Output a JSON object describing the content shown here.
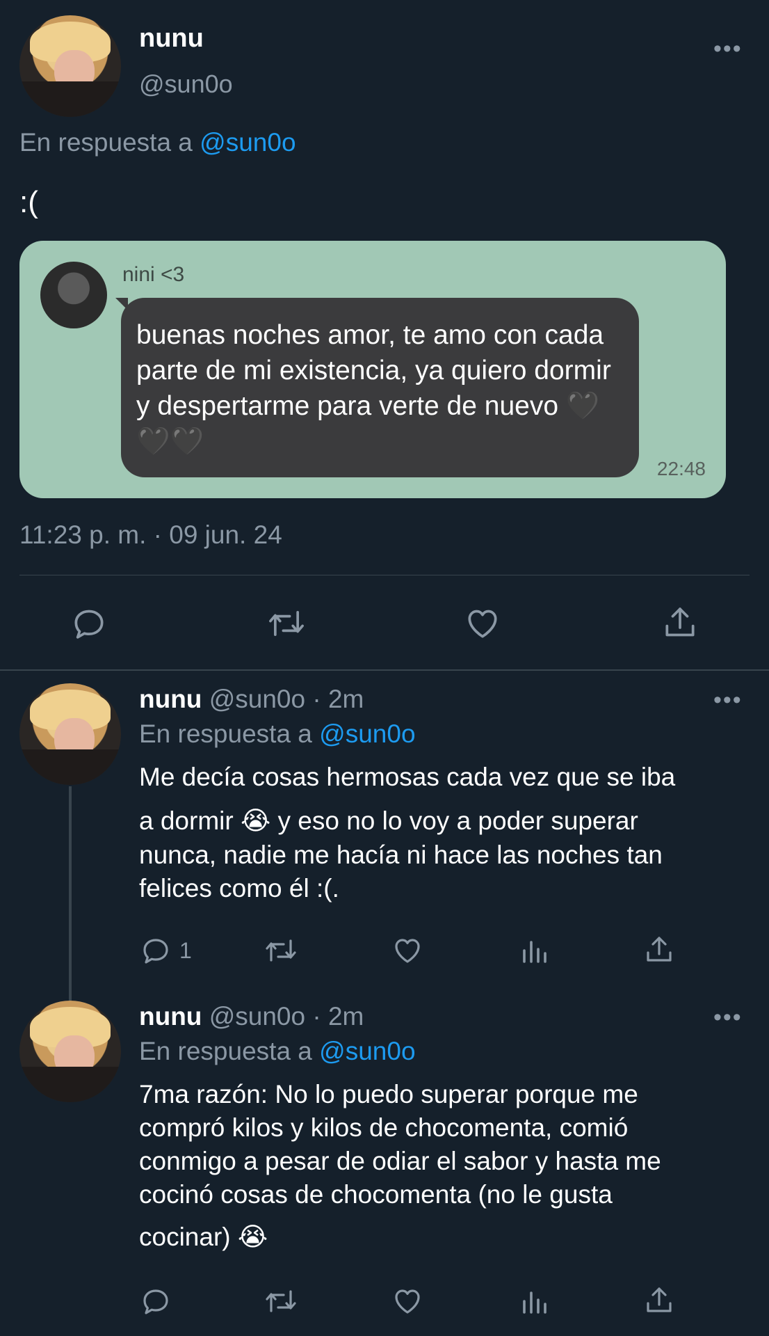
{
  "main_tweet": {
    "name": "nunu",
    "handle": "@sun0o",
    "reply_prefix": "En respuesta a",
    "reply_to": "@sun0o",
    "text": ":(",
    "timestamp": "11:23 p. m. · 09 jun. 24",
    "chat_image": {
      "sender": "nini <3",
      "message": "buenas noches amor, te amo con cada parte de mi existencia, ya quiero dormir y despertarme para verte de nuevo",
      "hearts": "🖤🖤🖤",
      "time": "22:48",
      "bg_color": "#a1c8b5",
      "bubble_color": "#3b3b3d"
    }
  },
  "replies": [
    {
      "name": "nunu",
      "handle": "@sun0o",
      "time": "· 2m",
      "reply_prefix": "En respuesta a",
      "reply_to": "@sun0o",
      "lines": [
        "Me decía cosas hermosas cada vez que se iba",
        "a dormir 😭  y eso no lo voy a poder superar",
        "nunca, nadie me hacía ni hace las noches tan",
        "felices como él :(."
      ],
      "reply_count": "1"
    },
    {
      "name": "nunu",
      "handle": "@sun0o",
      "time": "· 2m",
      "reply_prefix": "En respuesta a",
      "reply_to": "@sun0o",
      "lines": [
        "7ma razón: No lo puedo superar porque me",
        "compró kilos y kilos de chocomenta, comió",
        "conmigo a pesar de odiar el sabor y hasta me",
        "cocinó cosas de chocomenta (no le gusta",
        "cocinar) 😭"
      ],
      "reply_count": ""
    }
  ],
  "icons": [
    "more-icon",
    "reply-icon",
    "retweet-icon",
    "like-icon",
    "share-icon",
    "views-icon"
  ],
  "colors": {
    "background": "#15202b",
    "text": "#ffffff",
    "muted": "#8b98a5",
    "link": "#1d9bf0",
    "divider": "#38444d"
  }
}
